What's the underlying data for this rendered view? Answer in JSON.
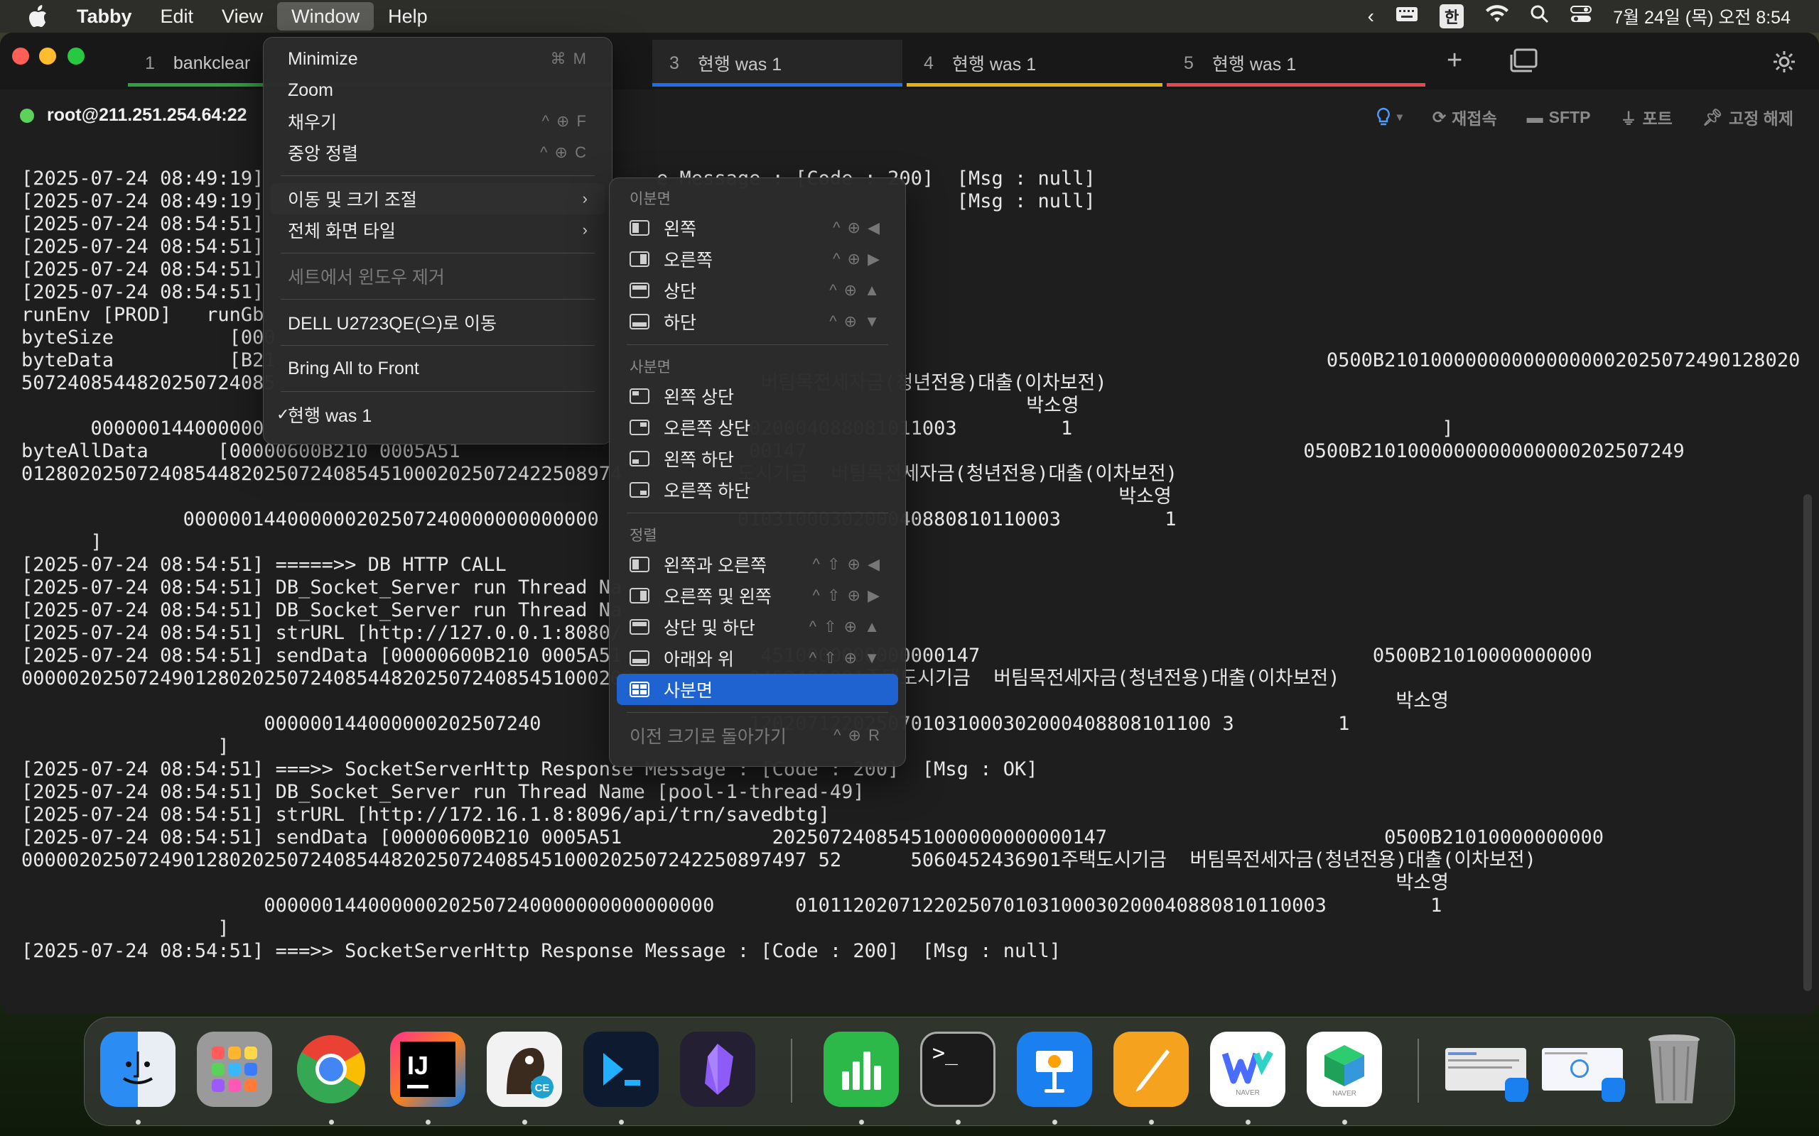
{
  "menubar": {
    "app": "Tabby",
    "items": [
      "Edit",
      "View",
      "Window",
      "Help"
    ],
    "active": "Window",
    "ime": "한",
    "clock": "7월 24일 (목) 오전 8:54"
  },
  "tabs": [
    {
      "num": "1",
      "title": "bankclear",
      "color": "#2ea043"
    },
    {
      "num": "3",
      "title": "현행 was 1",
      "color": "#1f6feb",
      "active": true
    },
    {
      "num": "4",
      "title": "현행 was 1",
      "color": "#e3b30b"
    },
    {
      "num": "5",
      "title": "현행 was 1",
      "color": "#e5484d"
    }
  ],
  "connection": {
    "host": "root@211.251.254.64:22",
    "tools": [
      "재접속",
      "SFTP",
      "포트",
      "고정 해제"
    ]
  },
  "terminal": {
    "lines": [
      "[2025-07-24 08:49:19]                                  e Message : [Code : 200]  [Msg : null]",
      "[2025-07-24 08:49:19]                                                            [Msg : null]",
      "[2025-07-24 08:54:51]",
      "[2025-07-24 08:54:51]",
      "[2025-07-24 08:54:51]",
      "[2025-07-24 08:54:51]",
      "runEnv [PROD]   runGb",
      "byteSize          [000",
      "byteData          [B21                                                                                           0500B210100000000000000002025072490128020",
      "5072408544820250724085                                          버팀목전세자금(청년전용)대출(이차보전)",
      "                                                                                       박소영",
      "      000000144000000                                         3020004088081011003         1                                ]",
      "byteAllData      [00000600B210 0005A51                         00147                                           0500B2101000000000000000202507249",
      "0128020250724085448202507240854510002025072422508974          도시기금  버팀목전세자금(청년전용)대출(이차보전)",
      "                                                                                               박소영",
      "              000000144000000202507240000000000000            0103100030200040880810110003         1",
      "      ]",
      "[2025-07-24 08:54:51] =====>> DB HTTP CALL",
      "[2025-07-24 08:54:51] DB_Socket_Server run Thread Na",
      "[2025-07-24 08:54:51] DB_Socket_Server run Thread Na",
      "[2025-07-24 08:54:51] strURL [http://127.0.0.1:8080/",
      "[2025-07-24 08:54:51] sendData [00000600B210 0005A51            4510000000000000147                                  0500B21010000000000",
      "00000202507249012802025072408544820250724085451000202          0452436901주택도시기금  버팀목전세자금(청년전용)대출(이차보전)",
      "                                                                                                                       박소영",
      "                     000000144000000202507240                  1202071220250701031000302000408808101100 3         1",
      "                 ]",
      "[2025-07-24 08:54:51] ===>> SocketServerHttp Response Message : [Code : 200]  [Msg : OK]",
      "[2025-07-24 08:54:51] DB_Socket_Server run Thread Name [pool-1-thread-49]",
      "[2025-07-24 08:54:51] strURL [http://172.16.1.8:8096/api/trn/savedbtg]",
      "[2025-07-24 08:54:51] sendData [00000600B210 0005A51             20250724085451000000000000147                        0500B21010000000000",
      "00000202507249012802025072408544820250724085451000202507242250897497 52      5060452436901주택도시기금  버팀목전세자금(청년전용)대출(이차보전)",
      "                                                                                                                       박소영",
      "                     000000144000000202507240000000000000000       0101120207122025070103100030200040880810110003         1",
      "                 ]",
      "[2025-07-24 08:54:51] ===>> SocketServerHttp Response Message : [Code : 200]  [Msg : null]"
    ]
  },
  "window_menu": {
    "items": [
      {
        "label": "Minimize",
        "shortcut": "⌘ M"
      },
      {
        "label": "Zoom",
        "shortcut": ""
      },
      {
        "label": "채우기",
        "shortcut": "^ ⊕ F"
      },
      {
        "label": "중앙 정렬",
        "shortcut": "^ ⊕ C"
      },
      {
        "label": "이동 및 크기 조절"
      },
      {
        "label": "전체 화면 타일"
      },
      {
        "label": "세트에서 윈도우 제거"
      },
      {
        "label": "DELL U2723QE(으)로 이동"
      },
      {
        "label": "Bring All to Front"
      },
      {
        "label": "현행 was 1"
      }
    ]
  },
  "submenu": {
    "section_halves": "이분면",
    "halves": [
      {
        "label": "왼쪽",
        "shortcut": "^ ⊕ ◀"
      },
      {
        "label": "오른쪽",
        "shortcut": "^ ⊕ ▶"
      },
      {
        "label": "상단",
        "shortcut": "^ ⊕ ▲"
      },
      {
        "label": "하단",
        "shortcut": "^ ⊕ ▼"
      }
    ],
    "section_quarters": "사분면",
    "quarters": [
      {
        "label": "왼쪽 상단"
      },
      {
        "label": "오른쪽 상단"
      },
      {
        "label": "왼쪽 하단"
      },
      {
        "label": "오른쪽 하단"
      }
    ],
    "section_arrange": "정렬",
    "arrange": [
      {
        "label": "왼쪽과 오른쪽",
        "shortcut": "^ ⇧ ⊕ ◀"
      },
      {
        "label": "오른쪽 및 왼쪽",
        "shortcut": "^ ⇧ ⊕ ▶"
      },
      {
        "label": "상단 및 하단",
        "shortcut": "^ ⇧ ⊕ ▲"
      },
      {
        "label": "아래와 위",
        "shortcut": "^ ⇧ ⊕ ▼"
      },
      {
        "label": "사분면",
        "shortcut": ""
      }
    ],
    "revert": {
      "label": "이전 크기로 돌아가기",
      "shortcut": "^ ⊕ R"
    }
  },
  "dock": {
    "apps": [
      {
        "name": "Finder",
        "color": "#2f8cf5"
      },
      {
        "name": "Launchpad",
        "color": "#8c8c8c"
      },
      {
        "name": "Chrome",
        "color": "#ffffff"
      },
      {
        "name": "IntelliJ IDEA",
        "color": "#111111",
        "label": "IJ"
      },
      {
        "name": "DBeaver CE",
        "color": "#f3f3f3",
        "label": "CE"
      },
      {
        "name": "Termius",
        "color": "#0e1a2e"
      },
      {
        "name": "Obsidian",
        "color": "#262233"
      },
      {
        "name": "Numbers",
        "color": "#2fb946"
      },
      {
        "name": "Terminal",
        "color": "#1a1a1a",
        "label": ">_"
      },
      {
        "name": "Keynote",
        "color": "#1a82f0"
      },
      {
        "name": "Pages",
        "color": "#f5a623"
      },
      {
        "name": "Naver Whale",
        "color": "#ffffff",
        "label": "NAVER"
      },
      {
        "name": "Naver Works",
        "color": "#ffffff",
        "label": "NAVER"
      }
    ]
  },
  "colors": {
    "accent": "#1e63d0",
    "tab_active_bar": "#1f6feb"
  }
}
